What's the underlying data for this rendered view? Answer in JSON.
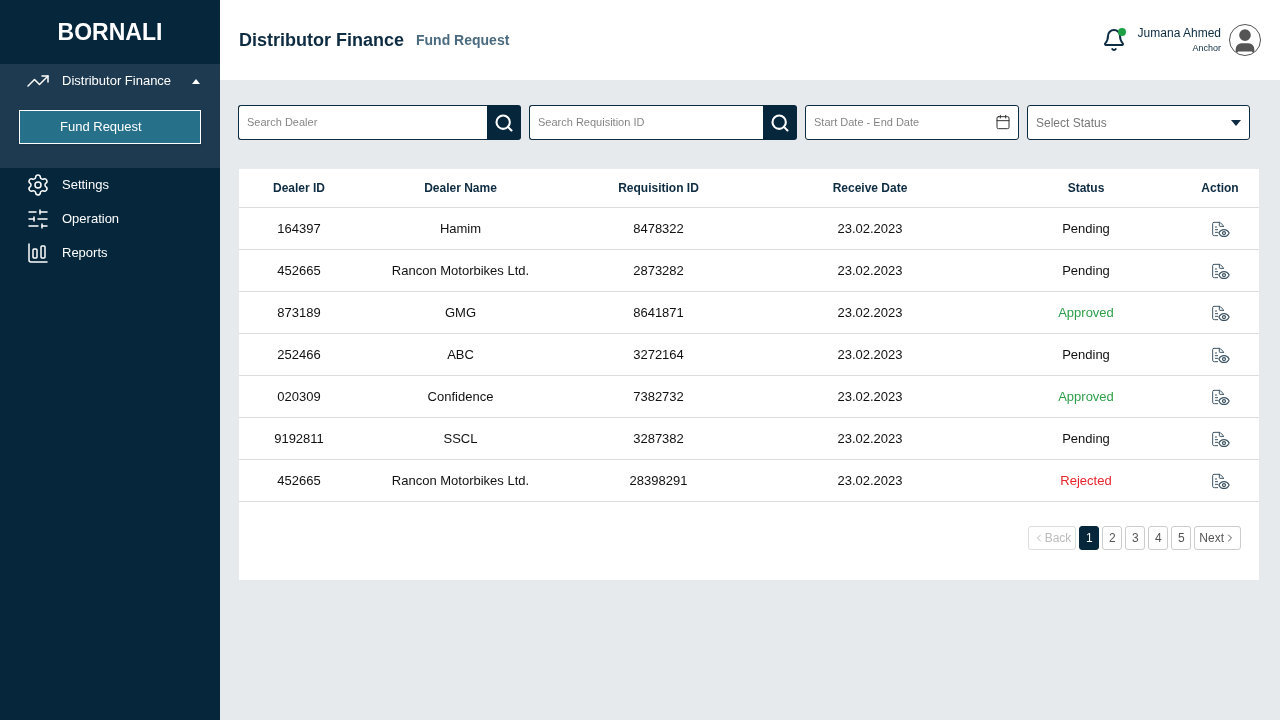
{
  "sidebar": {
    "logo": "BORNALI",
    "items": [
      {
        "label": "Distributor Finance",
        "expanded": true,
        "children": [
          {
            "label": "Fund Request",
            "selected": true
          }
        ]
      },
      {
        "label": "Settings",
        "expanded": false
      },
      {
        "label": "Operation",
        "expanded": false
      },
      {
        "label": "Reports",
        "expanded": false
      }
    ]
  },
  "header": {
    "title": "Distributor Finance",
    "subtitle": "Fund Request",
    "notification_unread": true,
    "user": {
      "name": "Jumana Ahmed",
      "role": "Anchor"
    }
  },
  "filters": {
    "dealer_search": {
      "placeholder": "Search Dealer"
    },
    "requisition_search": {
      "placeholder": "Search Requisition ID"
    },
    "date_range": {
      "placeholder": "Start Date - End Date"
    },
    "status_select": {
      "placeholder": "Select Status"
    }
  },
  "table": {
    "columns": [
      "Dealer ID",
      "Dealer Name",
      "Requisition ID",
      "Receive Date",
      "Status",
      "Action"
    ],
    "rows": [
      {
        "dealer_id": "164397",
        "dealer_name": "Hamim",
        "requisition_id": "8478322",
        "receive_date": "23.02.2023",
        "status": "Pending",
        "kind": "pending"
      },
      {
        "dealer_id": "452665",
        "dealer_name": "Rancon Motorbikes Ltd.",
        "requisition_id": "2873282",
        "receive_date": "23.02.2023",
        "status": "Pending",
        "kind": "pending"
      },
      {
        "dealer_id": "873189",
        "dealer_name": "GMG",
        "requisition_id": "8641871",
        "receive_date": "23.02.2023",
        "status": "Approved",
        "kind": "approved"
      },
      {
        "dealer_id": "252466",
        "dealer_name": "ABC",
        "requisition_id": "3272164",
        "receive_date": "23.02.2023",
        "status": "Pending",
        "kind": "pending"
      },
      {
        "dealer_id": "020309",
        "dealer_name": "Confidence",
        "requisition_id": "7382732",
        "receive_date": "23.02.2023",
        "status": "Approved",
        "kind": "approved"
      },
      {
        "dealer_id": "9192811",
        "dealer_name": "SSCL",
        "requisition_id": "3287382",
        "receive_date": "23.02.2023",
        "status": "Pending",
        "kind": "pending"
      },
      {
        "dealer_id": "452665",
        "dealer_name": "Rancon Motorbikes Ltd.",
        "requisition_id": "28398291",
        "receive_date": "23.02.2023",
        "status": "Rejected",
        "kind": "rejected"
      }
    ]
  },
  "pagination": {
    "back": {
      "label": "Back",
      "disabled": true
    },
    "pages": [
      {
        "label": "1",
        "selected": true
      },
      {
        "label": "2",
        "selected": false
      },
      {
        "label": "3",
        "selected": false
      },
      {
        "label": "4",
        "selected": false
      },
      {
        "label": "5",
        "selected": false
      }
    ],
    "next": {
      "label": "Next",
      "disabled": false
    }
  }
}
